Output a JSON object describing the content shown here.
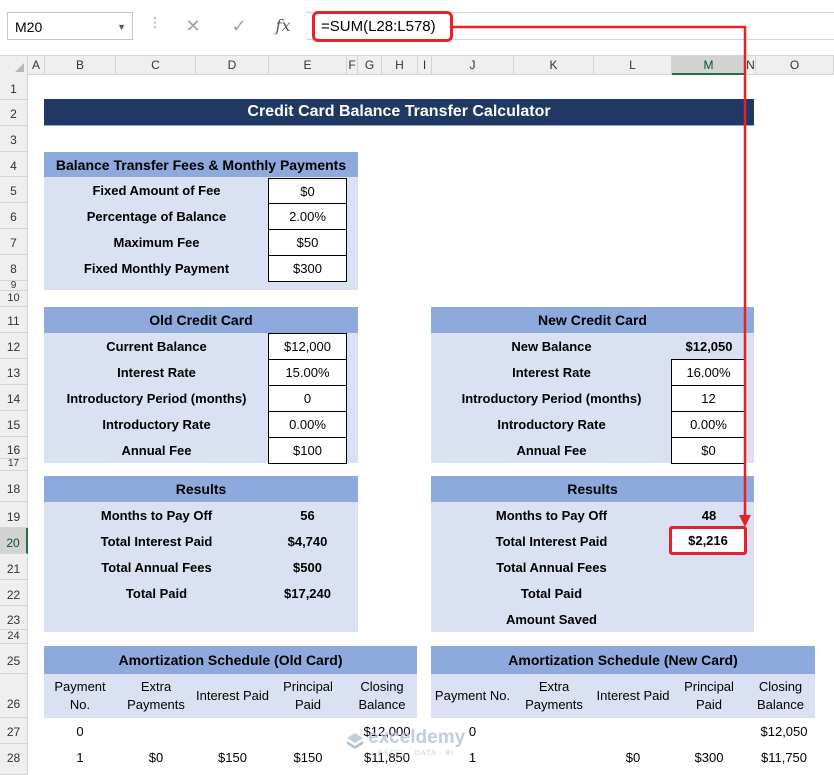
{
  "formula_bar": {
    "name_box": "M20",
    "formula": "=SUM(L28:L578)"
  },
  "columns": [
    "A",
    "B",
    "C",
    "D",
    "E",
    "F",
    "G",
    "H",
    "I",
    "J",
    "K",
    "L",
    "M",
    "N",
    "O"
  ],
  "rows": [
    "1",
    "2",
    "3",
    "4",
    "5",
    "6",
    "7",
    "8",
    "9",
    "10",
    "11",
    "12",
    "13",
    "14",
    "15",
    "16",
    "17",
    "18",
    "19",
    "20",
    "21",
    "22",
    "23",
    "24",
    "25",
    "26",
    "27",
    "28"
  ],
  "title": "Credit Card Balance Transfer Calculator",
  "fees": {
    "header": "Balance Transfer Fees & Monthly Payments",
    "items": [
      {
        "label": "Fixed Amount of Fee",
        "value": "$0"
      },
      {
        "label": "Percentage of Balance",
        "value": "2.00%"
      },
      {
        "label": "Maximum Fee",
        "value": "$50"
      },
      {
        "label": "Fixed Monthly Payment",
        "value": "$300"
      }
    ]
  },
  "old_card": {
    "header": "Old Credit Card",
    "items": [
      {
        "label": "Current Balance",
        "value": "$12,000"
      },
      {
        "label": "Interest Rate",
        "value": "15.00%"
      },
      {
        "label": "Introductory Period (months)",
        "value": "0"
      },
      {
        "label": "Introductory Rate",
        "value": "0.00%"
      },
      {
        "label": "Annual Fee",
        "value": "$100"
      }
    ]
  },
  "new_card": {
    "header": "New Credit Card",
    "items": [
      {
        "label": "New Balance",
        "value": "$12,050"
      },
      {
        "label": "Interest Rate",
        "value": "16.00%"
      },
      {
        "label": "Introductory Period (months)",
        "value": "12"
      },
      {
        "label": "Introductory Rate",
        "value": "0.00%"
      },
      {
        "label": "Annual Fee",
        "value": "$0"
      }
    ]
  },
  "old_results": {
    "header": "Results",
    "items": [
      {
        "label": "Months to Pay Off",
        "value": "56"
      },
      {
        "label": "Total Interest Paid",
        "value": "$4,740"
      },
      {
        "label": "Total Annual Fees",
        "value": "$500"
      },
      {
        "label": "Total Paid",
        "value": "$17,240"
      }
    ]
  },
  "new_results": {
    "header": "Results",
    "items": [
      {
        "label": "Months to Pay Off",
        "value": "48"
      },
      {
        "label": "Total Interest Paid",
        "value": "$2,216"
      },
      {
        "label": "Total Annual Fees",
        "value": ""
      },
      {
        "label": "Total Paid",
        "value": ""
      },
      {
        "label": "Amount Saved",
        "value": ""
      }
    ]
  },
  "old_schedule": {
    "header": "Amortization Schedule (Old Card)",
    "columns": [
      "Payment No.",
      "Extra Payments",
      "Interest Paid",
      "Principal Paid",
      "Closing Balance"
    ],
    "rows": [
      [
        "0",
        "",
        "",
        "",
        "$12,000"
      ],
      [
        "1",
        "$0",
        "$150",
        "$150",
        "$11,850"
      ]
    ]
  },
  "new_schedule": {
    "header": "Amortization Schedule (New Card)",
    "columns": [
      "Payment No.",
      "Extra Payments",
      "Interest Paid",
      "Principal Paid",
      "Closing Balance"
    ],
    "rows": [
      [
        "0",
        "",
        "",
        "",
        "$12,050"
      ],
      [
        "1",
        "",
        "$0",
        "$300",
        "$11,750"
      ]
    ]
  },
  "watermark": {
    "name": "exceldemy",
    "tagline": "EXCEL · DATA · BI"
  }
}
